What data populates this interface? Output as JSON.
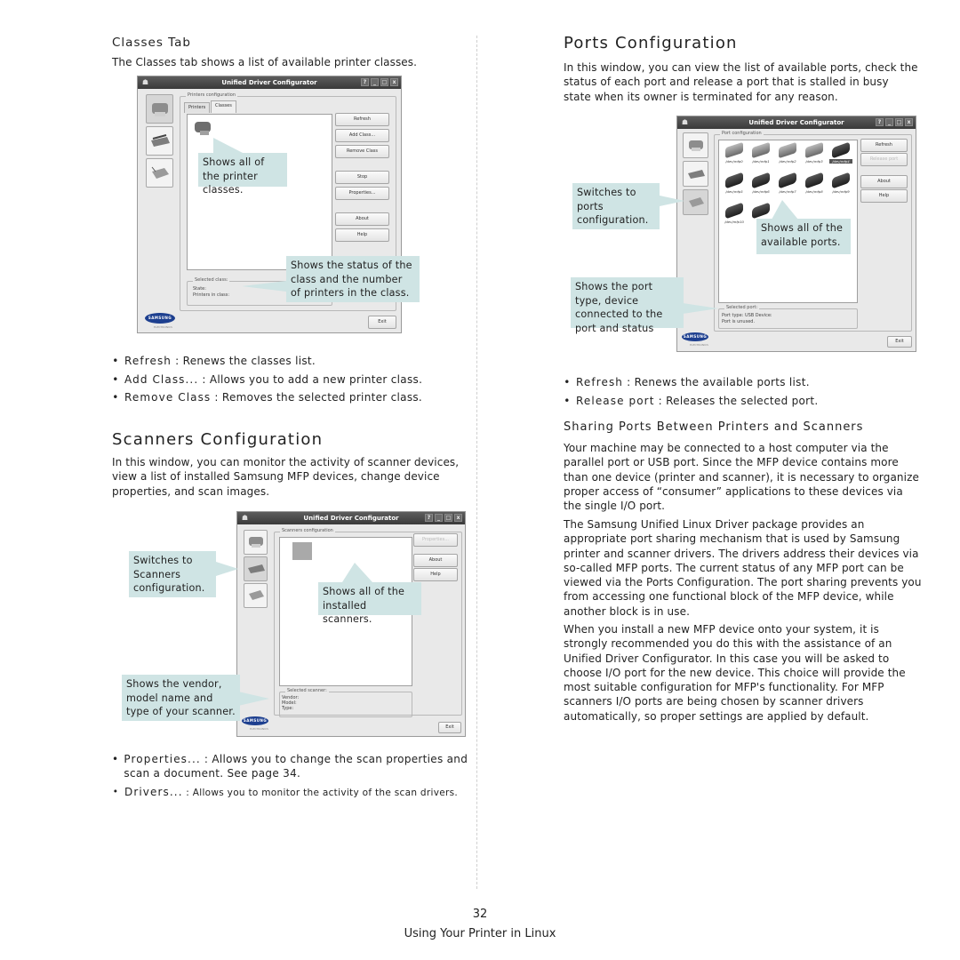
{
  "left_column": {
    "classes_tab": {
      "heading": "Classes Tab",
      "intro": "The Classes tab shows a list of available printer classes.",
      "window": {
        "title": "Unified Driver Configurator",
        "title_controls": [
          "?",
          "_",
          "□",
          "x"
        ],
        "group_label": "Printers configuration",
        "tabs": [
          {
            "label": "Printers",
            "active": false
          },
          {
            "label": "Classes",
            "active": true
          }
        ],
        "side_buttons": [
          {
            "icon": "printer-icon",
            "active": true
          },
          {
            "icon": "scanner-icon",
            "active": false
          },
          {
            "icon": "port-icon",
            "active": false
          }
        ],
        "buttons": [
          {
            "label": "Refresh",
            "enabled": true
          },
          {
            "label": "Add Class...",
            "enabled": true
          },
          {
            "label": "Remove Class",
            "enabled": true
          },
          {
            "label": "Stop",
            "enabled": true
          },
          {
            "label": "Properties...",
            "enabled": true
          },
          {
            "label": "About",
            "enabled": true
          },
          {
            "label": "Help",
            "enabled": true
          }
        ],
        "selected_group_label": "Selected class:",
        "selected_fields": [
          "State:",
          "Printers in class:"
        ],
        "logo_text": "SAMSUNG",
        "logo_sub": "ELECTRONICS",
        "exit_label": "Exit"
      },
      "callouts": {
        "list": "Shows all of the printer classes.",
        "status": "Shows the status of the class and the number of printers in the class."
      },
      "bullets": [
        {
          "key": "Refresh",
          "text": " : Renews the classes list."
        },
        {
          "key": "Add Class...",
          "text": " : Allows you to add a new printer class."
        },
        {
          "key": "Remove Class",
          "text": " : Removes the selected printer class."
        }
      ]
    },
    "scanners": {
      "heading": "Scanners Configuration",
      "intro": "In this window, you can monitor the activity of scanner devices, view a list of installed Samsung MFP devices, change device properties, and scan images.",
      "window": {
        "title": "Unified Driver Configurator",
        "title_controls": [
          "?",
          "_",
          "□",
          "x"
        ],
        "group_label": "Scanners configuration",
        "side_buttons": [
          {
            "icon": "printer-icon",
            "active": false
          },
          {
            "icon": "scanner-icon",
            "active": true
          },
          {
            "icon": "port-icon",
            "active": false
          }
        ],
        "buttons": [
          {
            "label": "Properties...",
            "enabled": false
          },
          {
            "label": "About",
            "enabled": true
          },
          {
            "label": "Help",
            "enabled": true
          }
        ],
        "selected_group_label": "Selected scanner:",
        "selected_fields": [
          "Vendor:",
          "Model:",
          "Type:"
        ],
        "logo_text": "SAMSUNG",
        "logo_sub": "ELECTRONICS",
        "exit_label": "Exit"
      },
      "callouts": {
        "switch": "Switches to Scanners configuration.",
        "list": "Shows all of the installed scanners.",
        "vendor": "Shows the vendor, model name and type of your scanner."
      },
      "bullets": [
        {
          "key": "Properties...",
          "text": " : Allows you to change the scan properties and scan a document. See page 34."
        },
        {
          "key": "Drivers...",
          "text": " : Allows you to monitor the activity of the scan drivers."
        }
      ]
    }
  },
  "right_column": {
    "ports": {
      "heading": "Ports Configuration",
      "intro": "In this window, you can view the list of available ports, check the status of each port and release a port that is stalled in busy state when its owner is terminated for any reason.",
      "window": {
        "title": "Unified Driver Configurator",
        "title_controls": [
          "?",
          "_",
          "□",
          "x"
        ],
        "group_label": "Port configuration",
        "side_buttons": [
          {
            "icon": "printer-icon",
            "active": false
          },
          {
            "icon": "scanner-icon",
            "active": false
          },
          {
            "icon": "port-icon",
            "active": true
          }
        ],
        "ports": [
          {
            "label": "/dev/mfp0",
            "type": "parallel",
            "selected": false
          },
          {
            "label": "/dev/mfp1",
            "type": "parallel",
            "selected": false
          },
          {
            "label": "/dev/mfp2",
            "type": "parallel",
            "selected": false
          },
          {
            "label": "/dev/mfp3",
            "type": "parallel",
            "selected": false
          },
          {
            "label": "/dev/mfp4",
            "type": "usb",
            "selected": true
          },
          {
            "label": "/dev/mfp5",
            "type": "usb",
            "selected": false
          },
          {
            "label": "/dev/mfp6",
            "type": "usb",
            "selected": false
          },
          {
            "label": "/dev/mfp7",
            "type": "usb",
            "selected": false
          },
          {
            "label": "/dev/mfp8",
            "type": "usb",
            "selected": false
          },
          {
            "label": "/dev/mfp9",
            "type": "usb",
            "selected": false
          },
          {
            "label": "/dev/mfp10",
            "type": "usb",
            "selected": false
          },
          {
            "label": "/de",
            "type": "usb",
            "selected": false
          }
        ],
        "buttons": [
          {
            "label": "Refresh",
            "enabled": true
          },
          {
            "label": "Release port",
            "enabled": false
          },
          {
            "label": "About",
            "enabled": true
          },
          {
            "label": "Help",
            "enabled": true
          }
        ],
        "selected_group_label": "Selected port:",
        "selected_fields": [
          "Port type: USB   Device:",
          "Port is unused."
        ],
        "logo_text": "SAMSUNG",
        "logo_sub": "ELECTRONICS",
        "exit_label": "Exit"
      },
      "callouts": {
        "switch": "Switches to ports configuration.",
        "list": "Shows all of the available ports.",
        "status": "Shows the port type, device connected to the port and status"
      },
      "bullets": [
        {
          "key": "Refresh",
          "text": " : Renews the available ports list."
        },
        {
          "key": "Release port",
          "text": " : Releases the selected port."
        }
      ]
    },
    "sharing": {
      "heading": "Sharing Ports Between Printers and Scanners",
      "paragraphs": [
        "Your machine may be connected to a host computer via the parallel port or USB port. Since the MFP device contains more than one device (printer and scanner), it is necessary to organize proper access of “consumer” applications to these devices via the single I/O port.",
        "The Samsung Unified Linux Driver package provides an appropriate port sharing mechanism that is used by Samsung printer and scanner drivers. The drivers address their devices via so-called MFP ports. The current status of any MFP port can be viewed via the Ports Configuration. The port sharing prevents you from accessing one functional block of the MFP device, while another block is in use.",
        "When you install a new MFP device onto your system, it is strongly recommended you do this with the assistance of an Unified Driver Configurator. In this case you will be asked to choose I/O port for the new device. This choice will provide the most suitable configuration for MFP's functionality. For MFP scanners I/O ports are being chosen by scanner drivers automatically, so proper settings are applied by default."
      ]
    }
  },
  "footer": {
    "page_number": "32",
    "chapter": "Using Your Printer in Linux"
  }
}
